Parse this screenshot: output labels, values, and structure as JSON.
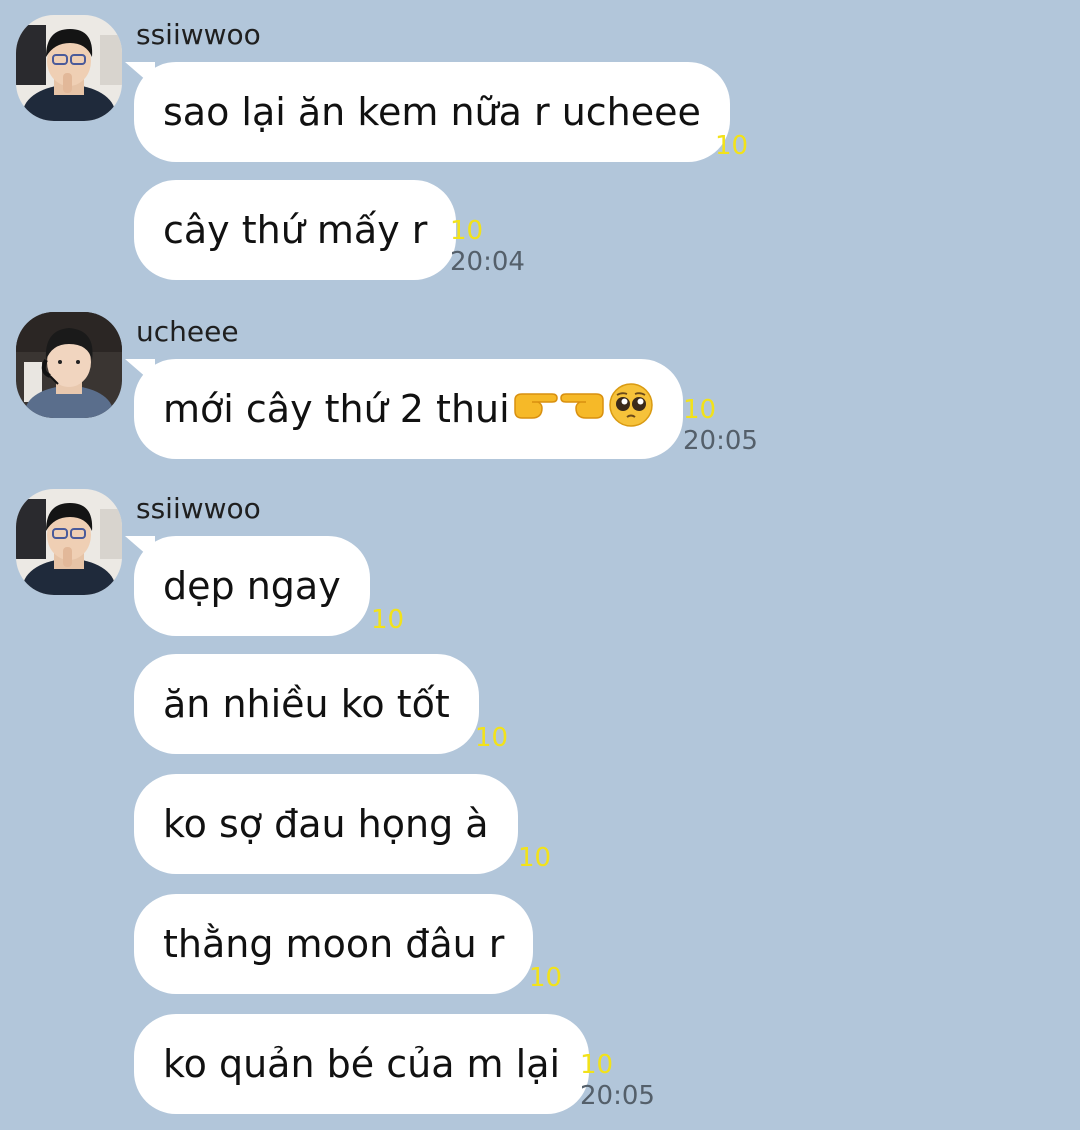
{
  "messages": [
    {
      "sender": "ssiiwwoo",
      "text": "sao lại ăn kem nữa r ucheee",
      "unread": "10",
      "time": ""
    },
    {
      "sender": "",
      "text": "cây thứ mấy r",
      "unread": "10",
      "time": "20:04"
    },
    {
      "sender": "ucheee",
      "text": "mới cây thứ 2 thui",
      "emoji": [
        "finger-pointing-right-icon",
        "finger-pointing-left-icon",
        "pleading-face-icon"
      ],
      "unread": "10",
      "time": "20:05"
    },
    {
      "sender": "ssiiwwoo",
      "text": "dẹp ngay",
      "unread": "10",
      "time": ""
    },
    {
      "sender": "",
      "text": "ăn nhiều ko tốt",
      "unread": "10",
      "time": ""
    },
    {
      "sender": "",
      "text": "ko sợ đau họng à",
      "unread": "10",
      "time": ""
    },
    {
      "sender": "",
      "text": "thằng moon đâu r",
      "unread": "10",
      "time": ""
    },
    {
      "sender": "",
      "text": "ko quản bé của m lại",
      "unread": "10",
      "time": "20:05"
    }
  ],
  "colors": {
    "background": "#b2c6da",
    "bubble": "#ffffff",
    "unread": "#f2e21a",
    "time": "#545f6a"
  }
}
